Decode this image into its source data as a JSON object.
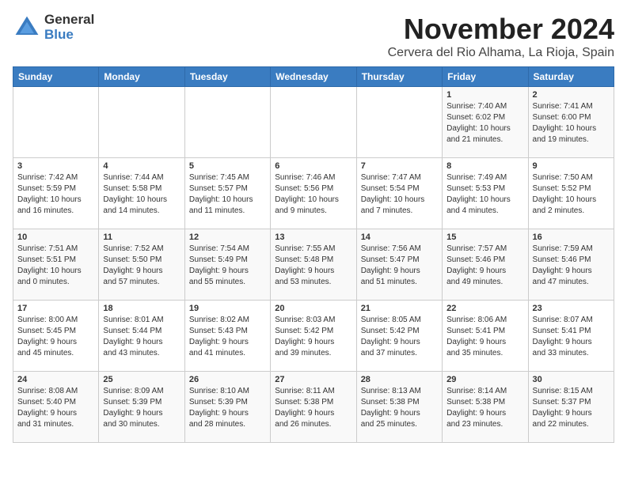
{
  "logo": {
    "general": "General",
    "blue": "Blue"
  },
  "title": "November 2024",
  "subtitle": "Cervera del Rio Alhama, La Rioja, Spain",
  "weekdays": [
    "Sunday",
    "Monday",
    "Tuesday",
    "Wednesday",
    "Thursday",
    "Friday",
    "Saturday"
  ],
  "weeks": [
    [
      {
        "day": "",
        "info": ""
      },
      {
        "day": "",
        "info": ""
      },
      {
        "day": "",
        "info": ""
      },
      {
        "day": "",
        "info": ""
      },
      {
        "day": "",
        "info": ""
      },
      {
        "day": "1",
        "info": "Sunrise: 7:40 AM\nSunset: 6:02 PM\nDaylight: 10 hours\nand 21 minutes."
      },
      {
        "day": "2",
        "info": "Sunrise: 7:41 AM\nSunset: 6:00 PM\nDaylight: 10 hours\nand 19 minutes."
      }
    ],
    [
      {
        "day": "3",
        "info": "Sunrise: 7:42 AM\nSunset: 5:59 PM\nDaylight: 10 hours\nand 16 minutes."
      },
      {
        "day": "4",
        "info": "Sunrise: 7:44 AM\nSunset: 5:58 PM\nDaylight: 10 hours\nand 14 minutes."
      },
      {
        "day": "5",
        "info": "Sunrise: 7:45 AM\nSunset: 5:57 PM\nDaylight: 10 hours\nand 11 minutes."
      },
      {
        "day": "6",
        "info": "Sunrise: 7:46 AM\nSunset: 5:56 PM\nDaylight: 10 hours\nand 9 minutes."
      },
      {
        "day": "7",
        "info": "Sunrise: 7:47 AM\nSunset: 5:54 PM\nDaylight: 10 hours\nand 7 minutes."
      },
      {
        "day": "8",
        "info": "Sunrise: 7:49 AM\nSunset: 5:53 PM\nDaylight: 10 hours\nand 4 minutes."
      },
      {
        "day": "9",
        "info": "Sunrise: 7:50 AM\nSunset: 5:52 PM\nDaylight: 10 hours\nand 2 minutes."
      }
    ],
    [
      {
        "day": "10",
        "info": "Sunrise: 7:51 AM\nSunset: 5:51 PM\nDaylight: 10 hours\nand 0 minutes."
      },
      {
        "day": "11",
        "info": "Sunrise: 7:52 AM\nSunset: 5:50 PM\nDaylight: 9 hours\nand 57 minutes."
      },
      {
        "day": "12",
        "info": "Sunrise: 7:54 AM\nSunset: 5:49 PM\nDaylight: 9 hours\nand 55 minutes."
      },
      {
        "day": "13",
        "info": "Sunrise: 7:55 AM\nSunset: 5:48 PM\nDaylight: 9 hours\nand 53 minutes."
      },
      {
        "day": "14",
        "info": "Sunrise: 7:56 AM\nSunset: 5:47 PM\nDaylight: 9 hours\nand 51 minutes."
      },
      {
        "day": "15",
        "info": "Sunrise: 7:57 AM\nSunset: 5:46 PM\nDaylight: 9 hours\nand 49 minutes."
      },
      {
        "day": "16",
        "info": "Sunrise: 7:59 AM\nSunset: 5:46 PM\nDaylight: 9 hours\nand 47 minutes."
      }
    ],
    [
      {
        "day": "17",
        "info": "Sunrise: 8:00 AM\nSunset: 5:45 PM\nDaylight: 9 hours\nand 45 minutes."
      },
      {
        "day": "18",
        "info": "Sunrise: 8:01 AM\nSunset: 5:44 PM\nDaylight: 9 hours\nand 43 minutes."
      },
      {
        "day": "19",
        "info": "Sunrise: 8:02 AM\nSunset: 5:43 PM\nDaylight: 9 hours\nand 41 minutes."
      },
      {
        "day": "20",
        "info": "Sunrise: 8:03 AM\nSunset: 5:42 PM\nDaylight: 9 hours\nand 39 minutes."
      },
      {
        "day": "21",
        "info": "Sunrise: 8:05 AM\nSunset: 5:42 PM\nDaylight: 9 hours\nand 37 minutes."
      },
      {
        "day": "22",
        "info": "Sunrise: 8:06 AM\nSunset: 5:41 PM\nDaylight: 9 hours\nand 35 minutes."
      },
      {
        "day": "23",
        "info": "Sunrise: 8:07 AM\nSunset: 5:41 PM\nDaylight: 9 hours\nand 33 minutes."
      }
    ],
    [
      {
        "day": "24",
        "info": "Sunrise: 8:08 AM\nSunset: 5:40 PM\nDaylight: 9 hours\nand 31 minutes."
      },
      {
        "day": "25",
        "info": "Sunrise: 8:09 AM\nSunset: 5:39 PM\nDaylight: 9 hours\nand 30 minutes."
      },
      {
        "day": "26",
        "info": "Sunrise: 8:10 AM\nSunset: 5:39 PM\nDaylight: 9 hours\nand 28 minutes."
      },
      {
        "day": "27",
        "info": "Sunrise: 8:11 AM\nSunset: 5:38 PM\nDaylight: 9 hours\nand 26 minutes."
      },
      {
        "day": "28",
        "info": "Sunrise: 8:13 AM\nSunset: 5:38 PM\nDaylight: 9 hours\nand 25 minutes."
      },
      {
        "day": "29",
        "info": "Sunrise: 8:14 AM\nSunset: 5:38 PM\nDaylight: 9 hours\nand 23 minutes."
      },
      {
        "day": "30",
        "info": "Sunrise: 8:15 AM\nSunset: 5:37 PM\nDaylight: 9 hours\nand 22 minutes."
      }
    ]
  ]
}
